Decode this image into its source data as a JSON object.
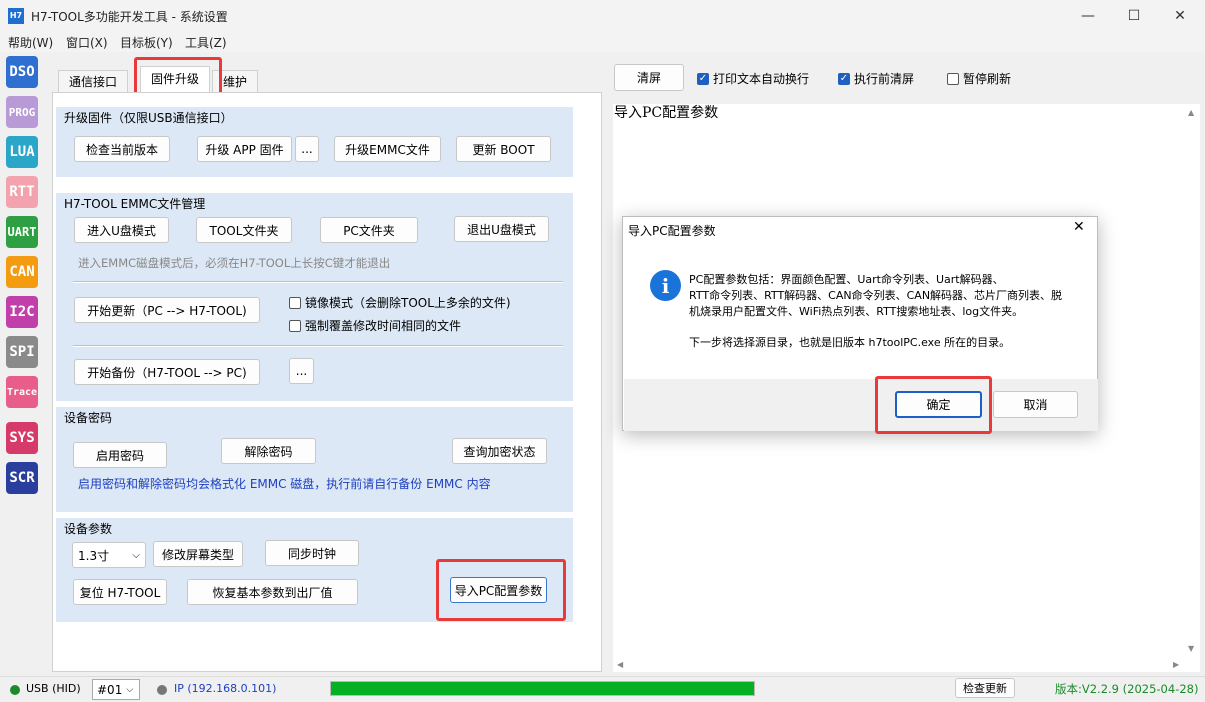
{
  "window": {
    "title": "H7-TOOL多功能开发工具 - 系统设置",
    "icon_text": "H7"
  },
  "menu": [
    "帮助(W)",
    "窗口(X)",
    "目标板(Y)",
    "工具(Z)"
  ],
  "sidebar": [
    {
      "label": "DSO",
      "color": "#2f6fd0"
    },
    {
      "label": "PROG",
      "color": "#b89ad6"
    },
    {
      "label": "LUA",
      "color": "#2aa6c8"
    },
    {
      "label": "RTT",
      "color": "#f2a3ad"
    },
    {
      "label": "UART",
      "color": "#2ea043"
    },
    {
      "label": "CAN",
      "color": "#f39c12"
    },
    {
      "label": "I2C",
      "color": "#c03fa8"
    },
    {
      "label": "SPI",
      "color": "#8a8a8a"
    },
    {
      "label": "Trace",
      "color": "#e85d8a"
    },
    {
      "label": "SYS",
      "color": "#d63a6a"
    },
    {
      "label": "SCR",
      "color": "#2a3f9d"
    }
  ],
  "tabs": [
    "通信接口",
    "固件升级",
    "维护"
  ],
  "upgrade": {
    "title": "升级固件（仅限USB通信接口）",
    "check_version": "检查当前版本",
    "upgrade_app": "升级 APP 固件",
    "ellipsis": "...",
    "upgrade_emmc": "升级EMMC文件",
    "update_boot": "更新 BOOT"
  },
  "emmc": {
    "title": "H7-TOOL EMMC文件管理",
    "enter_udisk": "进入U盘模式",
    "tool_folder": "TOOL文件夹",
    "pc_folder": "PC文件夹",
    "exit_udisk": "退出U盘模式",
    "hint": "进入EMMC磁盘模式后，必须在H7-TOOL上长按C键才能退出",
    "start_update": "开始更新（PC --> H7-TOOL)",
    "mirror_mode": "镜像模式（会删除TOOL上多余的文件)",
    "force_overwrite": "强制覆盖修改时间相同的文件",
    "start_backup": "开始备份（H7-TOOL --> PC)",
    "ellipsis": "..."
  },
  "password": {
    "title": "设备密码",
    "enable": "启用密码",
    "remove": "解除密码",
    "query": "查询加密状态",
    "warning": "启用密码和解除密码均会格式化 EMMC 磁盘，执行前请自行备份 EMMC 内容"
  },
  "params": {
    "title": "设备参数",
    "screen_size": "1.3寸",
    "modify_screen": "修改屏幕类型",
    "sync_clock": "同步时钟",
    "reset": "复位 H7-TOOL",
    "restore": "恢复基本参数到出厂值",
    "import_pc": "导入PC配置参数"
  },
  "right_toolbar": {
    "clear": "清屏",
    "auto_wrap": "打印文本自动换行",
    "clear_before": "执行前清屏",
    "pause_refresh": "暂停刷新"
  },
  "log_text": "导入PC配置参数",
  "dialog": {
    "title": "导入PC配置参数",
    "line1": "PC配置参数包括：界面颜色配置、Uart命令列表、Uart解码器、",
    "line2": "RTT命令列表、RTT解码器、CAN命令列表、CAN解码器、芯片厂商列表、脱",
    "line3": "机烧录用户配置文件、WiFi热点列表、RTT搜索地址表、log文件夹。",
    "line4": "下一步将选择源目录，也就是旧版本 h7toolPC.exe 所在的目录。",
    "ok": "确定",
    "cancel": "取消"
  },
  "status": {
    "usb": "USB (HID)",
    "device": "#01",
    "ip": "IP (192.168.0.101)",
    "progress": 1.0,
    "check_update": "检查更新",
    "version": "版本:V2.2.9 (2025-04-28)"
  }
}
